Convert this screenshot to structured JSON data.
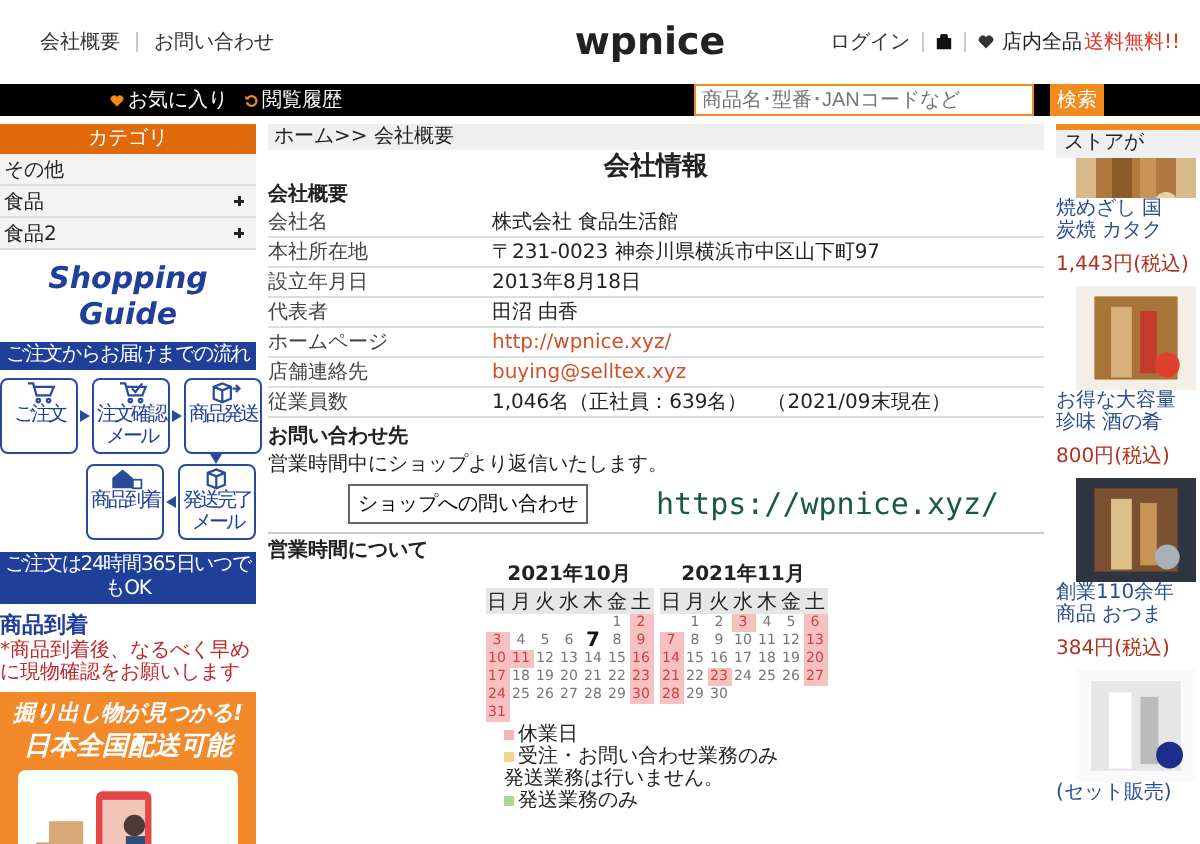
{
  "header": {
    "links": [
      "会社概要",
      "お問い合わせ"
    ],
    "logo": "wpnice",
    "login": "ログイン",
    "notice_label": "店内全品",
    "notice_highlight": "送料無料!!"
  },
  "nav": {
    "favorites": "お気に入り",
    "history": "閲覧履歴",
    "search": {
      "placeholder": "商品名･型番･JANコードなど"
    },
    "search_button": "検索"
  },
  "sidebar": {
    "title": "カテゴリ",
    "categories": [
      {
        "label": "その他",
        "expandable": false
      },
      {
        "label": "食品",
        "expandable": true
      },
      {
        "label": "食品2",
        "expandable": true
      }
    ],
    "guide": {
      "title": "Shopping Guide",
      "flow_title": "ご注文からお届けまでの流れ",
      "steps": [
        {
          "kind": "cart",
          "label": "ご注文"
        },
        {
          "kind": "cart-check",
          "label": "注文確認メール"
        },
        {
          "kind": "box-send",
          "label": "商品発送"
        },
        {
          "kind": "house",
          "label": "商品到着"
        },
        {
          "kind": "box-mail",
          "label": "発送完了メール"
        }
      ],
      "banner": "ご注文は24時間365日いつでもOK",
      "arrival_title": "商品到着",
      "arrival_note": "*商品到着後、なるべく早めに現物確認をお願いします"
    },
    "promo": {
      "lines": [
        "掘り出し物が見つかる!",
        "日本全国配送可能"
      ],
      "kind": "picture"
    }
  },
  "main": {
    "breadcrumb": "ホーム>> 会社概要",
    "title": "会社情報",
    "section": "会社概要",
    "rows": [
      {
        "label": "会社名",
        "value": "株式会社 食品生活館",
        "kind": "text"
      },
      {
        "label": "本社所在地",
        "value": "〒231-0023 神奈川県横浜市中区山下町97",
        "kind": "text"
      },
      {
        "label": "設立年月日",
        "value": "2013年8月18日",
        "kind": "text"
      },
      {
        "label": "代表者",
        "value": "田沼 由香",
        "kind": "text"
      },
      {
        "label": "ホームページ",
        "value": "http://wpnice.xyz/",
        "kind": "link"
      },
      {
        "label": "店舗連絡先",
        "value": "buying@selltex.xyz",
        "kind": "link"
      },
      {
        "label": "従業員数",
        "value": "1,046名（正社員：639名）　（2021/09末現在）",
        "kind": "text"
      }
    ],
    "contact": {
      "title": "お問い合わせ先",
      "text": "営業時間中にショップより返信いたします。",
      "button": "ショップへの問い合わせ",
      "url": "https://wpnice.xyz/"
    },
    "hours": {
      "title": "営業時間について",
      "calendars": [
        {
          "title": "2021年10月",
          "weekdays": [
            "日",
            "月",
            "火",
            "水",
            "木",
            "金",
            "土"
          ],
          "weeks": [
            [
              {
                "kind": "blank"
              },
              {
                "kind": "blank"
              },
              {
                "kind": "blank"
              },
              {
                "kind": "blank"
              },
              {
                "kind": "blank"
              },
              {
                "kind": "day",
                "day": "1",
                "holiday": false,
                "today": false
              },
              {
                "kind": "day",
                "day": "2",
                "holiday": true,
                "today": false
              }
            ],
            [
              {
                "kind": "day",
                "day": "3",
                "holiday": true,
                "today": false
              },
              {
                "kind": "day",
                "day": "4",
                "holiday": false,
                "today": false
              },
              {
                "kind": "day",
                "day": "5",
                "holiday": false,
                "today": false
              },
              {
                "kind": "day",
                "day": "6",
                "holiday": false,
                "today": false
              },
              {
                "kind": "day",
                "day": "7",
                "holiday": false,
                "today": true
              },
              {
                "kind": "day",
                "day": "8",
                "holiday": false,
                "today": false
              },
              {
                "kind": "day",
                "day": "9",
                "holiday": true,
                "today": false
              }
            ],
            [
              {
                "kind": "day",
                "day": "10",
                "holiday": true,
                "today": false
              },
              {
                "kind": "day",
                "day": "11",
                "holiday": true,
                "today": false
              },
              {
                "kind": "day",
                "day": "12",
                "holiday": false,
                "today": false
              },
              {
                "kind": "day",
                "day": "13",
                "holiday": false,
                "today": false
              },
              {
                "kind": "day",
                "day": "14",
                "holiday": false,
                "today": false
              },
              {
                "kind": "day",
                "day": "15",
                "holiday": false,
                "today": false
              },
              {
                "kind": "day",
                "day": "16",
                "holiday": true,
                "today": false
              }
            ],
            [
              {
                "kind": "day",
                "day": "17",
                "holiday": true,
                "today": false
              },
              {
                "kind": "day",
                "day": "18",
                "holiday": false,
                "today": false
              },
              {
                "kind": "day",
                "day": "19",
                "holiday": false,
                "today": false
              },
              {
                "kind": "day",
                "day": "20",
                "holiday": false,
                "today": false
              },
              {
                "kind": "day",
                "day": "21",
                "holiday": false,
                "today": false
              },
              {
                "kind": "day",
                "day": "22",
                "holiday": false,
                "today": false
              },
              {
                "kind": "day",
                "day": "23",
                "holiday": true,
                "today": false
              }
            ],
            [
              {
                "kind": "day",
                "day": "24",
                "holiday": true,
                "today": false
              },
              {
                "kind": "day",
                "day": "25",
                "holiday": false,
                "today": false
              },
              {
                "kind": "day",
                "day": "26",
                "holiday": false,
                "today": false
              },
              {
                "kind": "day",
                "day": "27",
                "holiday": false,
                "today": false
              },
              {
                "kind": "day",
                "day": "28",
                "holiday": false,
                "today": false
              },
              {
                "kind": "day",
                "day": "29",
                "holiday": false,
                "today": false
              },
              {
                "kind": "day",
                "day": "30",
                "holiday": true,
                "today": false
              }
            ],
            [
              {
                "kind": "day",
                "day": "31",
                "holiday": true,
                "today": false
              }
            ]
          ]
        },
        {
          "title": "2021年11月",
          "weekdays": [
            "日",
            "月",
            "火",
            "水",
            "木",
            "金",
            "土"
          ],
          "weeks": [
            [
              {
                "kind": "blank"
              },
              {
                "kind": "day",
                "day": "1",
                "holiday": false,
                "today": false
              },
              {
                "kind": "day",
                "day": "2",
                "holiday": false,
                "today": false
              },
              {
                "kind": "day",
                "day": "3",
                "holiday": true,
                "today": false
              },
              {
                "kind": "day",
                "day": "4",
                "holiday": false,
                "today": false
              },
              {
                "kind": "day",
                "day": "5",
                "holiday": false,
                "today": false
              },
              {
                "kind": "day",
                "day": "6",
                "holiday": true,
                "today": false
              }
            ],
            [
              {
                "kind": "day",
                "day": "7",
                "holiday": true,
                "today": false
              },
              {
                "kind": "day",
                "day": "8",
                "holiday": false,
                "today": false
              },
              {
                "kind": "day",
                "day": "9",
                "holiday": false,
                "today": false
              },
              {
                "kind": "day",
                "day": "10",
                "holiday": false,
                "today": false
              },
              {
                "kind": "day",
                "day": "11",
                "holiday": false,
                "today": false
              },
              {
                "kind": "day",
                "day": "12",
                "holiday": false,
                "today": false
              },
              {
                "kind": "day",
                "day": "13",
                "holiday": true,
                "today": false
              }
            ],
            [
              {
                "kind": "day",
                "day": "14",
                "holiday": true,
                "today": false
              },
              {
                "kind": "day",
                "day": "15",
                "holiday": false,
                "today": false
              },
              {
                "kind": "day",
                "day": "16",
                "holiday": false,
                "today": false
              },
              {
                "kind": "day",
                "day": "17",
                "holiday": false,
                "today": false
              },
              {
                "kind": "day",
                "day": "18",
                "holiday": false,
                "today": false
              },
              {
                "kind": "day",
                "day": "19",
                "holiday": false,
                "today": false
              },
              {
                "kind": "day",
                "day": "20",
                "holiday": true,
                "today": false
              }
            ],
            [
              {
                "kind": "day",
                "day": "21",
                "holiday": true,
                "today": false
              },
              {
                "kind": "day",
                "day": "22",
                "holiday": false,
                "today": false
              },
              {
                "kind": "day",
                "day": "23",
                "holiday": true,
                "today": false
              },
              {
                "kind": "day",
                "day": "24",
                "holiday": false,
                "today": false
              },
              {
                "kind": "day",
                "day": "25",
                "holiday": false,
                "today": false
              },
              {
                "kind": "day",
                "day": "26",
                "holiday": false,
                "today": false
              },
              {
                "kind": "day",
                "day": "27",
                "holiday": true,
                "today": false
              }
            ],
            [
              {
                "kind": "day",
                "day": "28",
                "holiday": true,
                "today": false
              },
              {
                "kind": "day",
                "day": "29",
                "holiday": false,
                "today": false
              },
              {
                "kind": "day",
                "day": "30",
                "holiday": false,
                "today": false
              }
            ]
          ]
        }
      ],
      "legend": [
        {
          "color": "#f4b6b6",
          "text": "休業日"
        },
        {
          "color": "#f3d58f",
          "text": "受注・お問い合わせ業務のみ",
          "note": "発送業務は行いません。"
        },
        {
          "color": "#a9d98f",
          "text": "発送業務のみ"
        }
      ]
    }
  },
  "ranking": {
    "title": "ストアが",
    "products": [
      {
        "lines": [
          "焼めざし 国",
          "炭焼 カタク"
        ],
        "price": "1,443円(税込)"
      },
      {
        "lines": [
          "お得な大容量",
          "珍味 酒の肴"
        ],
        "price": "800円(税込)"
      },
      {
        "lines": [
          "創業110余年",
          "商品 おつま"
        ],
        "price": "384円(税込)"
      },
      {
        "lines": [
          "(セット販売)"
        ]
      }
    ]
  }
}
